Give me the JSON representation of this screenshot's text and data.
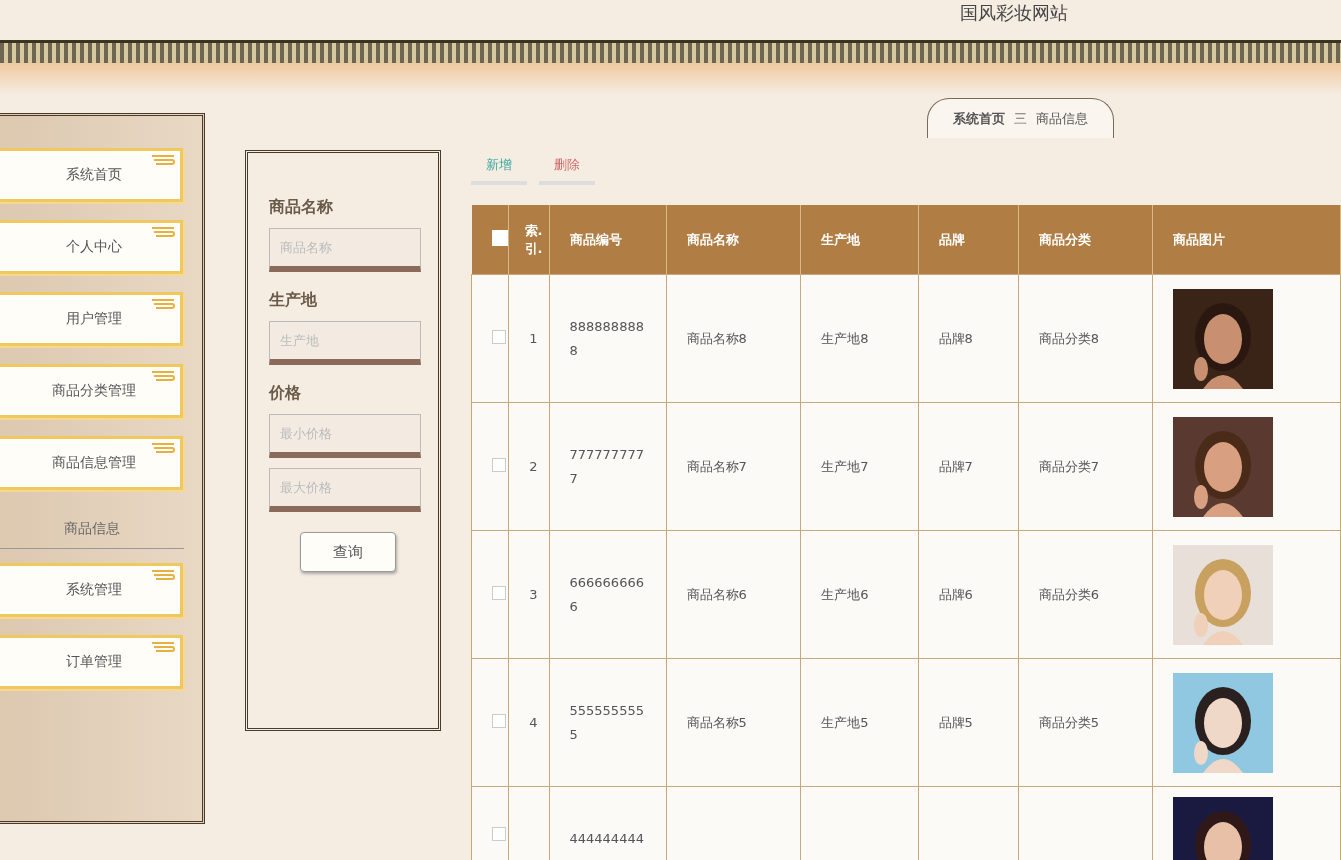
{
  "site_title": "国风彩妆网站",
  "breadcrumb": [
    "系统首页",
    "三",
    "商品信息"
  ],
  "sidebar": {
    "items": [
      {
        "label": "系统首页",
        "kind": "button"
      },
      {
        "label": "个人中心",
        "kind": "button"
      },
      {
        "label": "用户管理",
        "kind": "button"
      },
      {
        "label": "商品分类管理",
        "kind": "button"
      },
      {
        "label": "商品信息管理",
        "kind": "button"
      },
      {
        "label": "商品信息",
        "kind": "heading"
      },
      {
        "label": "系统管理",
        "kind": "button"
      },
      {
        "label": "订单管理",
        "kind": "button"
      }
    ]
  },
  "search": {
    "fields": [
      {
        "label": "商品名称",
        "placeholder": "商品名称"
      },
      {
        "label": "生产地",
        "placeholder": "生产地"
      },
      {
        "label": "价格",
        "placeholder": "最小价格"
      },
      {
        "placeholder": "最大价格"
      }
    ],
    "button": "查询"
  },
  "actions": [
    {
      "label": "新增",
      "kind": "add"
    },
    {
      "label": "删除",
      "kind": "delete"
    }
  ],
  "table": {
    "select_all": {
      "checked": false
    },
    "columns": [
      "索.引.",
      "商品编号",
      "商品名称",
      "生产地",
      "品牌",
      "商品分类",
      "商品图片"
    ],
    "rows": [
      {
        "checked": false,
        "index": "1",
        "code": "8888888888",
        "name": "商品名称8",
        "origin": "生产地8",
        "brand": "品牌8",
        "category": "商品分类8"
      },
      {
        "checked": false,
        "index": "2",
        "code": "7777777777",
        "name": "商品名称7",
        "origin": "生产地7",
        "brand": "品牌7",
        "category": "商品分类7"
      },
      {
        "checked": false,
        "index": "3",
        "code": "6666666666",
        "name": "商品名称6",
        "origin": "生产地6",
        "brand": "品牌6",
        "category": "商品分类6"
      },
      {
        "checked": false,
        "index": "4",
        "code": "5555555555",
        "name": "商品名称5",
        "origin": "生产地5",
        "brand": "品牌5",
        "category": "商品分类5"
      },
      {
        "checked": false,
        "code": "444444444"
      }
    ]
  }
}
